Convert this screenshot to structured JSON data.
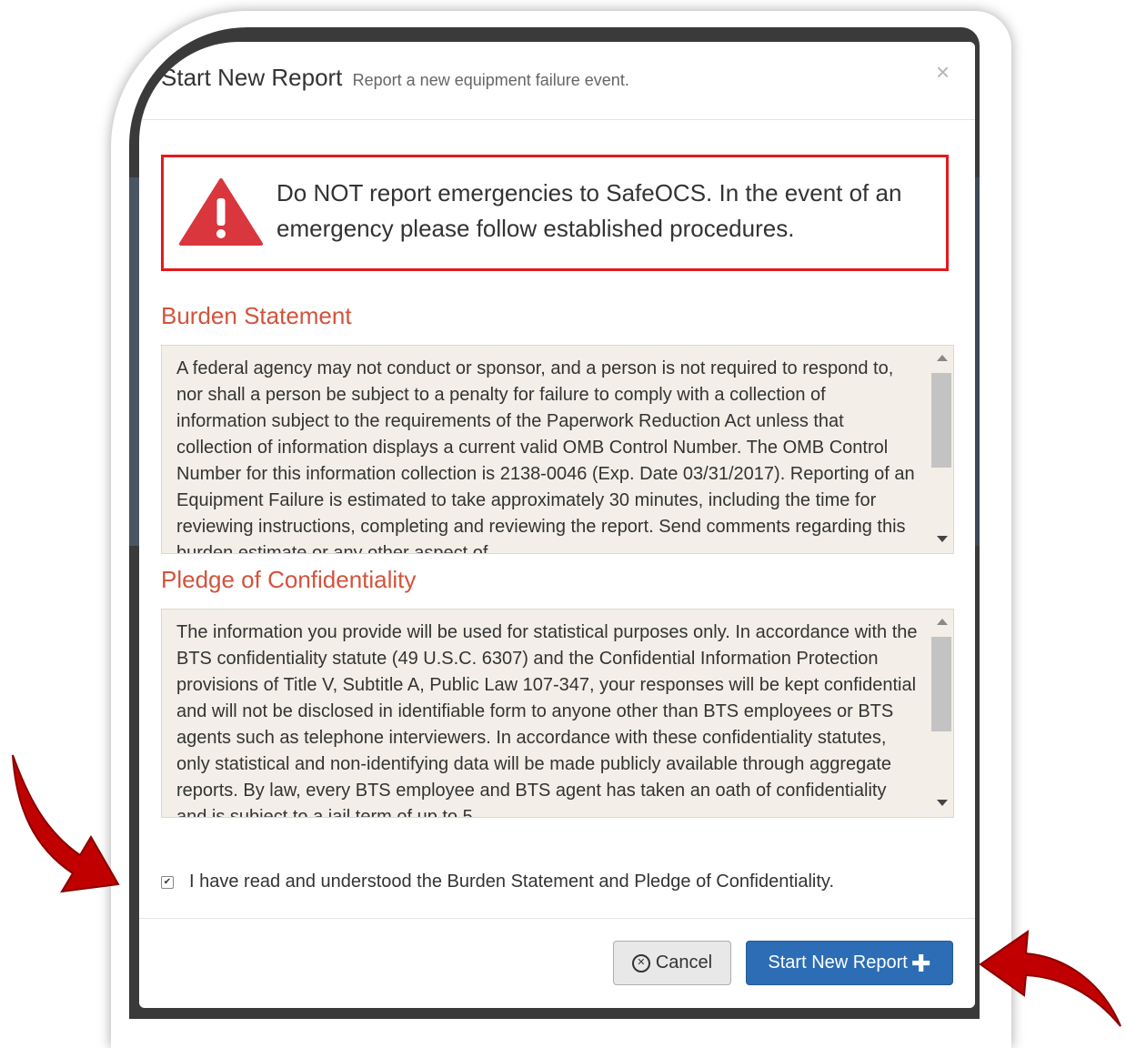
{
  "modal": {
    "title": "Start New Report",
    "subtitle": "Report a new equipment failure event.",
    "close": "×"
  },
  "warning": {
    "icon": "warning-triangle-icon",
    "text": "Do NOT report emergencies to SafeOCS. In the event of an emergency please follow established procedures."
  },
  "burden": {
    "title": "Burden Statement",
    "text": "A federal agency may not conduct or sponsor, and a person is not required to respond to, nor shall a person be subject to a penalty for failure to comply with a collection of information subject to the requirements of the Paperwork Reduction Act unless that collection of information displays a current valid OMB Control Number. The OMB Control Number for this information collection is 2138-0046 (Exp. Date 03/31/2017). Reporting of an Equipment Failure is estimated to take approximately 30 minutes, including the time for reviewing instructions, completing and reviewing the report. Send comments regarding this burden estimate or any other aspect of"
  },
  "pledge": {
    "title": "Pledge of Confidentiality",
    "text": "The information you provide will be used for statistical purposes only. In accordance with the BTS confidentiality statute (49 U.S.C. 6307) and the Confidential Information Protection provisions of Title V, Subtitle A, Public Law 107-347, your responses will be kept confidential and will not be disclosed in identifiable form to anyone other than BTS employees or BTS agents such as telephone interviewers. In accordance with these confidentiality statutes, only statistical and non-identifying data will be made publicly available through aggregate reports. By law, every BTS employee and BTS agent has taken an oath of confidentiality and is subject to a jail term of up to 5"
  },
  "agreement": {
    "checked": true,
    "label": "I have read and understood the Burden Statement and Pledge of Confidentiality."
  },
  "buttons": {
    "cancel": "Cancel",
    "start": "Start New Report"
  },
  "colors": {
    "warning_border": "#e5191c",
    "section_title": "#d2533c",
    "primary_button": "#2c6db5",
    "arrow": "#c00000"
  }
}
